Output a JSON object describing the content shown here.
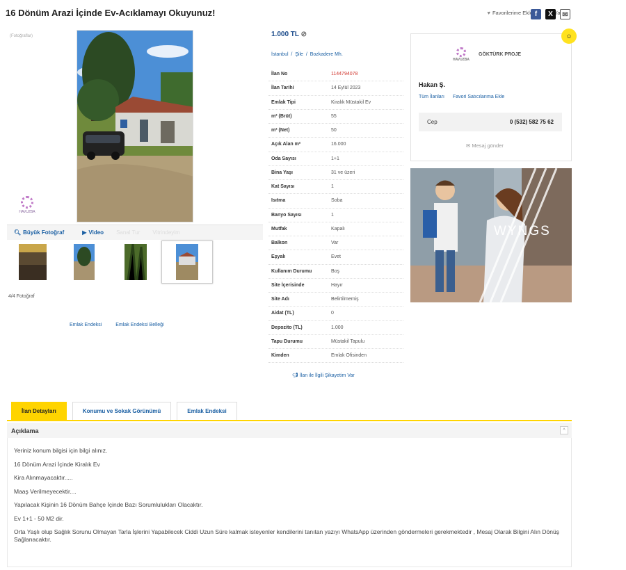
{
  "title": "16 Dönüm Arazi İçinde Ev-Acıklamayı Okuyunuz!",
  "top_actions": [
    {
      "icon": "heart-icon",
      "label": "Favorilerime Ekle"
    },
    {
      "icon": "print-icon",
      "label": "Yazdır"
    }
  ],
  "share": {
    "facebook": "f",
    "x": "X",
    "mail": "✉"
  },
  "gallery": {
    "small_label": "(Fotoğraflar)",
    "watermark": "HAVUZBA",
    "bar": {
      "big_photo": "Büyük Fotoğraf",
      "video": "Video",
      "disabled1": "Sanal Tur",
      "disabled2": "Vitrindeyim"
    },
    "thumb_count": "4/4 Fotoğraf"
  },
  "emlak_links": [
    "Emlak Endeksi",
    "Emlak Endeksi Belleği"
  ],
  "listing": {
    "price": "1.000 TL",
    "location": [
      "İstanbul",
      "Şile",
      "Bozkadere Mh."
    ],
    "details": [
      {
        "k": "İlan No",
        "v": "1144794078",
        "red": true
      },
      {
        "k": "İlan Tarihi",
        "v": "14 Eylül 2023"
      },
      {
        "k": "Emlak Tipi",
        "v": "Kiralık Müstakil Ev"
      },
      {
        "k": "m² (Brüt)",
        "v": "55"
      },
      {
        "k": "m² (Net)",
        "v": "50"
      },
      {
        "k": "Açık Alan m²",
        "v": "16.000"
      },
      {
        "k": "Oda Sayısı",
        "v": "1+1"
      },
      {
        "k": "Bina Yaşı",
        "v": "31 ve üzeri"
      },
      {
        "k": "Kat Sayısı",
        "v": "1"
      },
      {
        "k": "Isıtma",
        "v": "Soba"
      },
      {
        "k": "Banyo Sayısı",
        "v": "1"
      },
      {
        "k": "Mutfak",
        "v": "Kapalı"
      },
      {
        "k": "Balkon",
        "v": "Var"
      },
      {
        "k": "Eşyalı",
        "v": "Evet"
      },
      {
        "k": "Kullanım Durumu",
        "v": "Boş"
      },
      {
        "k": "Site İçerisinde",
        "v": "Hayır"
      },
      {
        "k": "Site Adı",
        "v": "Belirtilmemiş"
      },
      {
        "k": "Aidat (TL)",
        "v": "0"
      },
      {
        "k": "Depozito (TL)",
        "v": "1.000"
      },
      {
        "k": "Tapu Durumu",
        "v": "Müstakil Tapulu"
      },
      {
        "k": "Kimden",
        "v": "Emlak Ofisinden"
      }
    ],
    "complaint": "İlan ile İlgili Şikayetim Var"
  },
  "seller": {
    "logo_small": "HAVUZBA",
    "company": "GÖKTÜRK PROJE",
    "person": "Hakan Ş.",
    "links": [
      "Tüm İlanları",
      "Favori Satıcılarıma Ekle"
    ],
    "phone_label": "Cep",
    "phone": "0 (532) 582 75 62",
    "message": "Mesaj gönder",
    "badge": "☺"
  },
  "ad": {
    "brand": "WYNGS"
  },
  "tabs": [
    "İlan Detayları",
    "Konumu ve Sokak Görünümü",
    "Emlak Endeksi"
  ],
  "description": {
    "heading": "Açıklama",
    "collapse": "^",
    "paragraphs": [
      "Yeriniz konum bilgisi için bilgi alınız.",
      "16 Dönüm Arazi İçinde Kiralık Ev",
      "Kira Alınmayacaktır.....",
      "Maaş Verilmeyecektir....",
      "Yapılacak Kişinin 16 Dönüm Bahçe İçinde Bazı Sorumlulukları Olacaktır.",
      "Ev 1+1 - 50 M2 dir.",
      "Orta Yaşlı olup Sağlık Sorunu Olmayan Tarla İşlerini Yapabilecek Ciddi Uzun Süre kalmak isteyenler kendilerini tanıtan yazıyı WhatsApp üzerinden göndermeleri gerekmektedir , Mesaj Olarak Bilgini Alın Dönüş Sağlanacaktır."
    ]
  }
}
